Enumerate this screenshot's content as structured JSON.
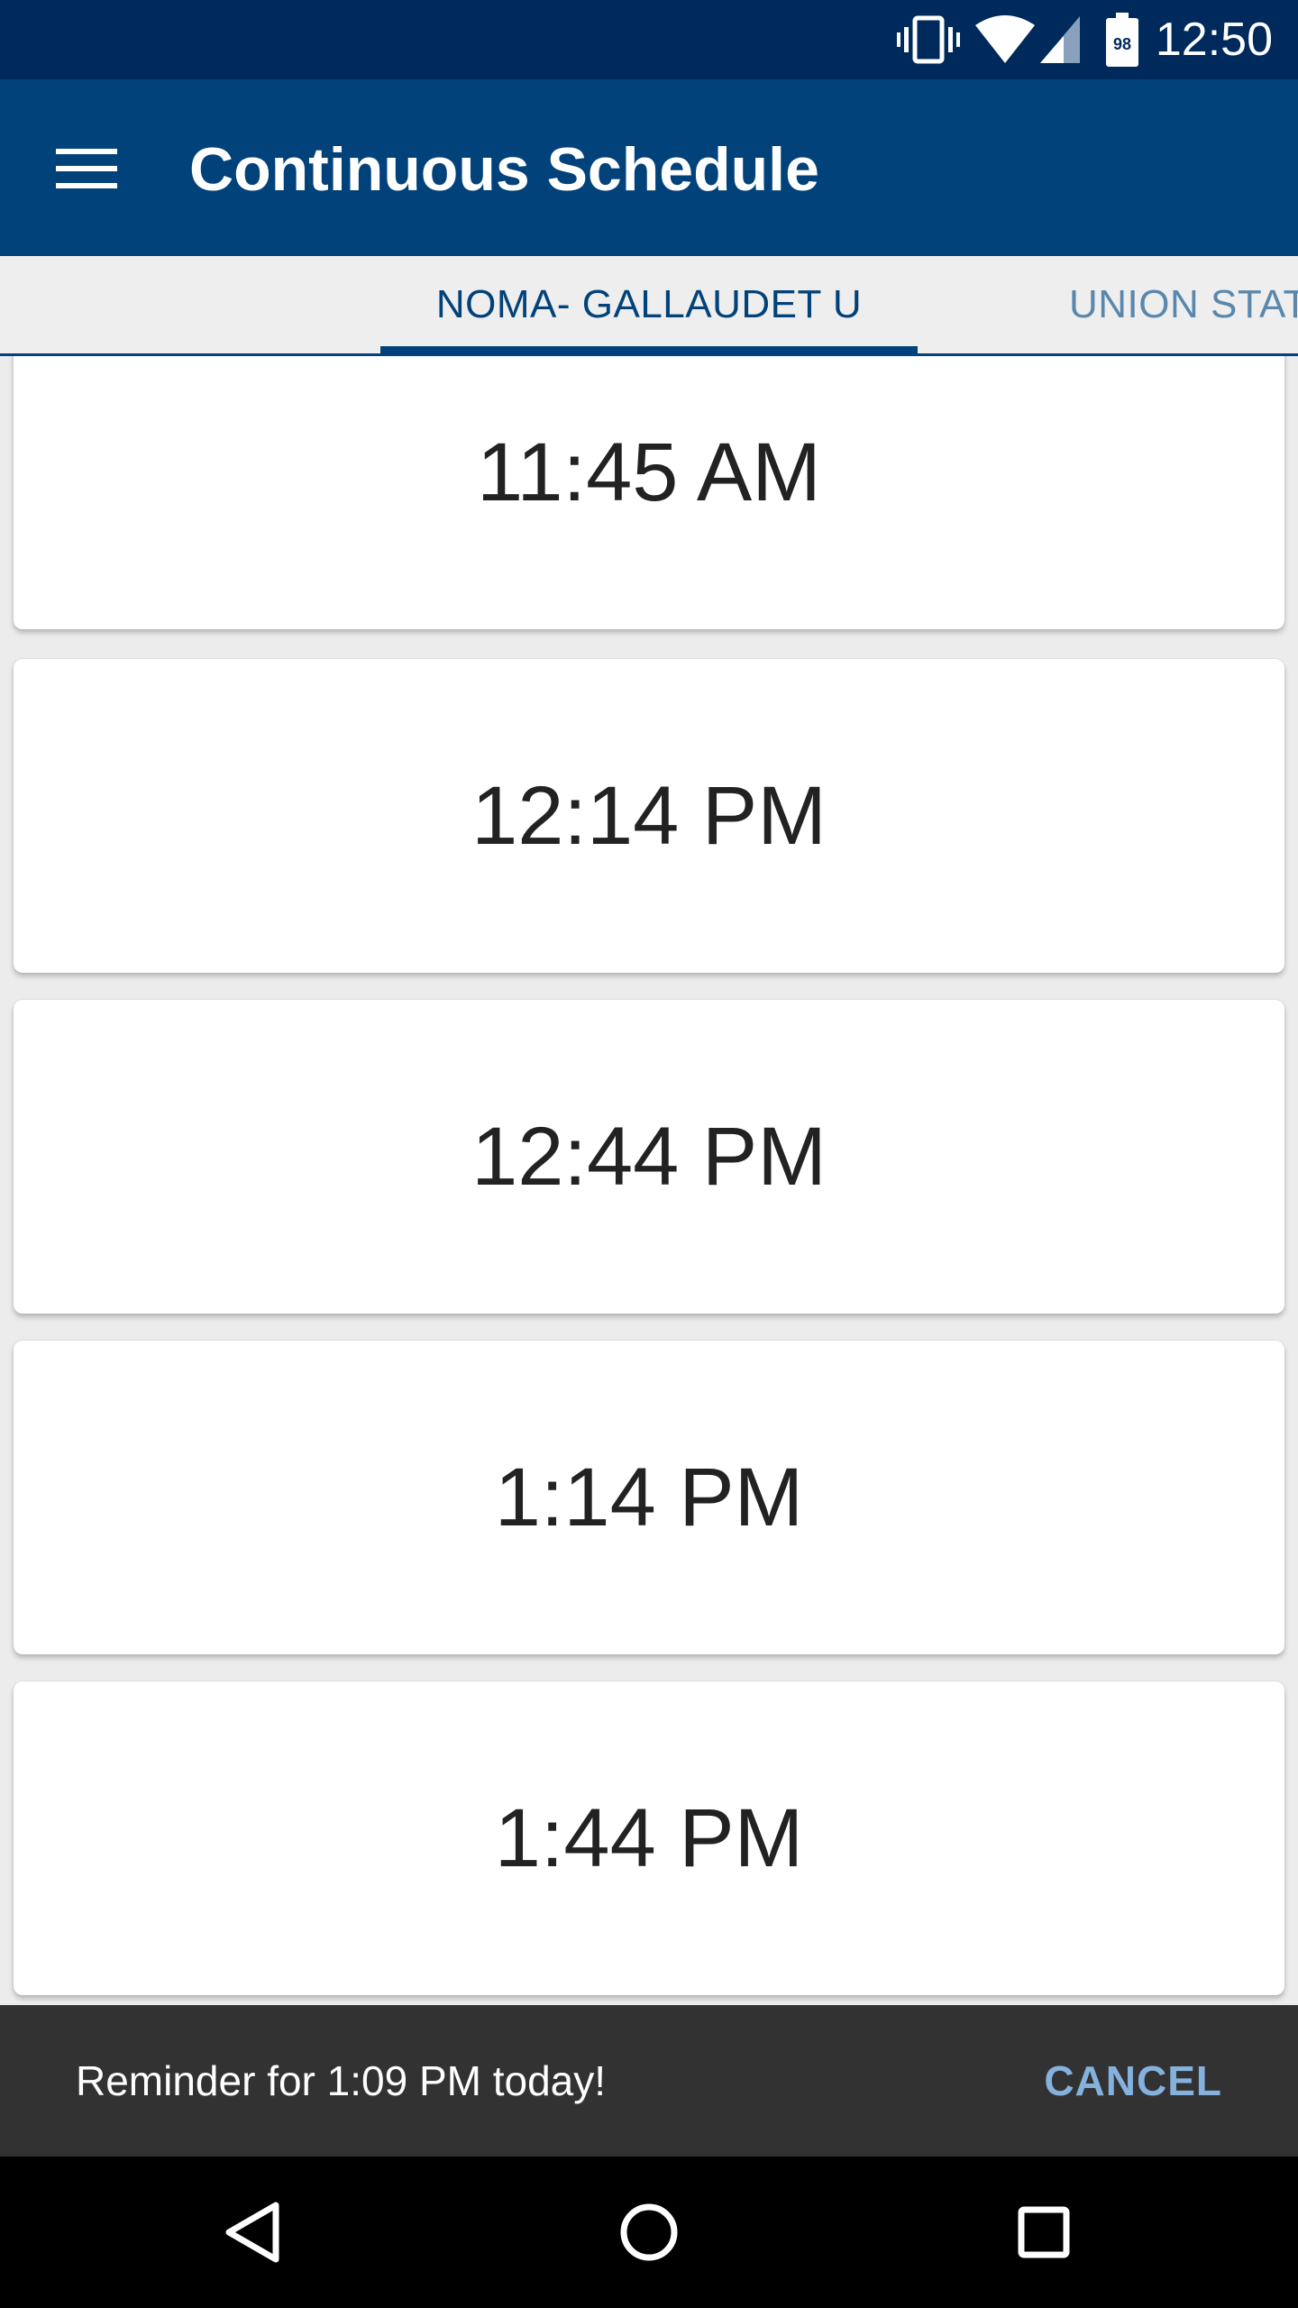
{
  "status_bar": {
    "time": "12:50",
    "battery_level": "98",
    "icons": [
      "vibrate-icon",
      "wifi-icon",
      "signal-icon",
      "battery-icon"
    ]
  },
  "app_bar": {
    "title": "Continuous Schedule",
    "menu_icon": "hamburger-menu-icon"
  },
  "tabs": [
    {
      "label": "NOMA- GALLAUDET U",
      "active": true
    },
    {
      "label": "UNION STAT",
      "active": false
    }
  ],
  "schedule": {
    "times": [
      "11:45 AM",
      "12:14 PM",
      "12:44 PM",
      "1:14 PM",
      "1:44 PM"
    ]
  },
  "snackbar": {
    "message": "Reminder for 1:09 PM today!",
    "action": "CANCEL"
  },
  "nav_bar": {
    "buttons": [
      "back-icon",
      "home-icon",
      "recents-icon"
    ]
  },
  "colors": {
    "status_bar": "#002a5c",
    "app_bar": "#02427a",
    "tab_active": "#02427a",
    "tab_inactive": "#5a87ad",
    "snackbar": "#323232",
    "snackbar_action": "#84b1dd"
  }
}
